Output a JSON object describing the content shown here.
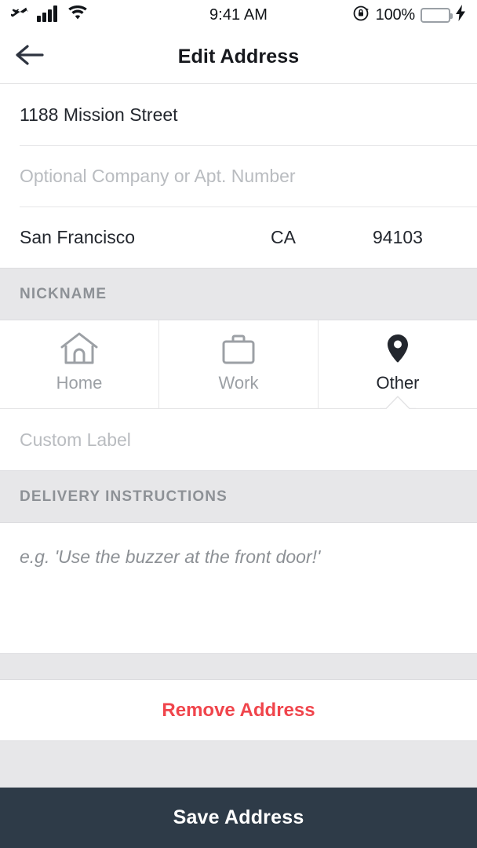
{
  "status_bar": {
    "airplane_icon": "airplane-icon",
    "signal_icon": "signal-bars-icon",
    "wifi_icon": "wifi-icon",
    "time": "9:41 AM",
    "rotation_lock_icon": "rotation-lock-icon",
    "battery_percent": "100%",
    "battery_icon": "battery-icon",
    "battery_color": "#45dd5c",
    "charging_icon": "charging-bolt-icon"
  },
  "nav": {
    "back_icon": "back-arrow-icon",
    "title": "Edit Address"
  },
  "address_form": {
    "street": "1188 Mission Street",
    "apt_placeholder": "Optional Company or Apt. Number",
    "city": "San Francisco",
    "state": "CA",
    "zip": "94103"
  },
  "nickname": {
    "header": "NICKNAME",
    "tabs": [
      {
        "label": "Home",
        "icon": "home-icon",
        "selected": false
      },
      {
        "label": "Work",
        "icon": "briefcase-icon",
        "selected": false
      },
      {
        "label": "Other",
        "icon": "map-pin-icon",
        "selected": true
      }
    ],
    "custom_label_placeholder": "Custom Label"
  },
  "delivery": {
    "header": "DELIVERY INSTRUCTIONS",
    "placeholder": "e.g. 'Use the buzzer at the front door!'"
  },
  "actions": {
    "remove_label": "Remove Address",
    "remove_color": "#f0454c",
    "save_label": "Save Address",
    "save_bg": "#2e3b48"
  }
}
